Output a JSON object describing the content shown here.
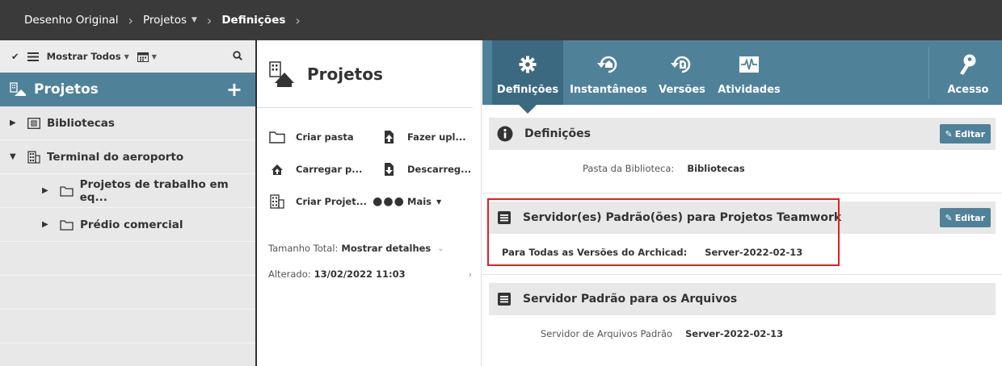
{
  "breadcrumb": {
    "item1": "Desenho Original",
    "item2": "Projetos",
    "item3": "Definições"
  },
  "left": {
    "toolbar": {
      "show_all": "Mostrar Todos"
    },
    "header": "Projetos",
    "tree": [
      {
        "label": "Bibliotecas"
      },
      {
        "label": "Terminal do aeroporto"
      },
      {
        "label": "Projetos de trabalho em eq..."
      },
      {
        "label": "Prédio comercial"
      }
    ]
  },
  "middle": {
    "title": "Projetos",
    "actions": {
      "create_folder": "Criar pasta",
      "upload": "Fazer upl...",
      "load": "Carregar p...",
      "download": "Descarreg...",
      "create_project": "Criar Projet...",
      "more": "Mais"
    },
    "total_size_label": "Tamanho Total:",
    "total_size_value": "Mostrar detalhes",
    "modified_label": "Alterado:",
    "modified_value": "13/02/2022 11:03"
  },
  "tabs": {
    "settings": "Definições",
    "snapshots": "Instantâneos",
    "versions": "Versões",
    "activities": "Atividades",
    "access": "Acesso"
  },
  "sections": {
    "definitions": {
      "title": "Definições",
      "edit": "Editar",
      "field_label": "Pasta da Biblioteca:",
      "field_value": "Bibliotecas"
    },
    "default_servers": {
      "title": "Servidor(es) Padrão(ões) para Projetos Teamwork",
      "edit": "Editar",
      "field_label": "Para Todas as Versões do Archicad:",
      "field_value": "Server-2022-02-13"
    },
    "file_server": {
      "title": "Servidor Padrão para os Arquivos",
      "field_label": "Servidor de Arquivos Padrão",
      "field_value": "Server-2022-02-13"
    }
  },
  "colors": {
    "accent": "#4f8299",
    "accent_dark": "#3b6a80",
    "topbar": "#3a3a3a",
    "highlight": "#e02020"
  }
}
